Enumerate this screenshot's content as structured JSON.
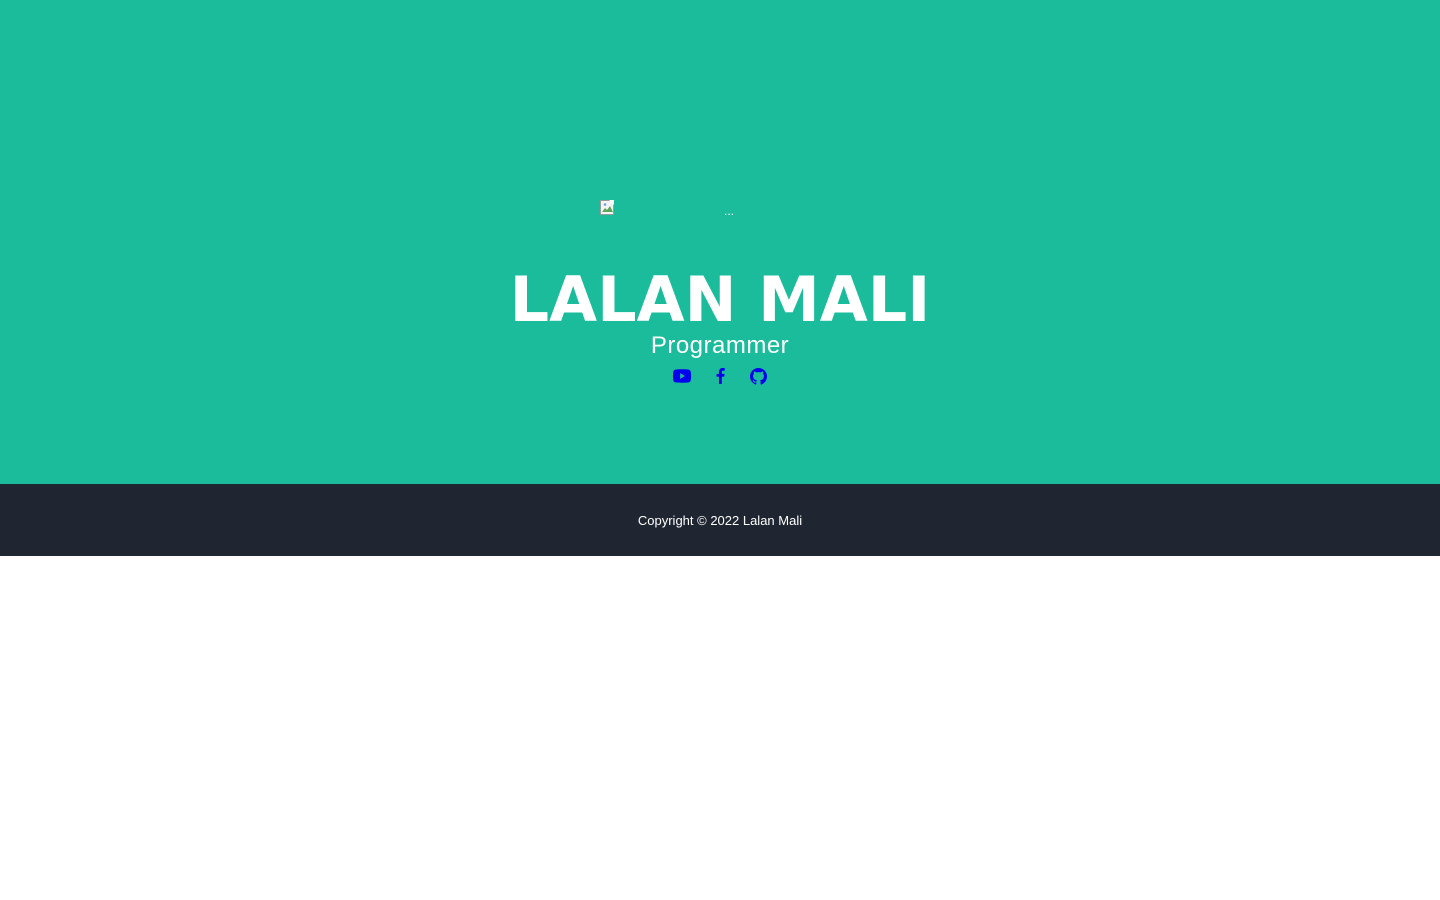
{
  "masthead": {
    "background_color": "#1abc9c",
    "avatar": {
      "alt": "...",
      "icon": "broken-image-icon"
    },
    "name": "LALAN MALI",
    "role": "Programmer",
    "social_links": [
      {
        "icon": "youtube-icon",
        "color": "#0000ee"
      },
      {
        "icon": "facebook-icon",
        "color": "#0000ee"
      },
      {
        "icon": "github-icon",
        "color": "#0000ee"
      }
    ]
  },
  "footer": {
    "background_color": "#1f2631",
    "copyright": "Copyright © 2022 Lalan Mali"
  }
}
